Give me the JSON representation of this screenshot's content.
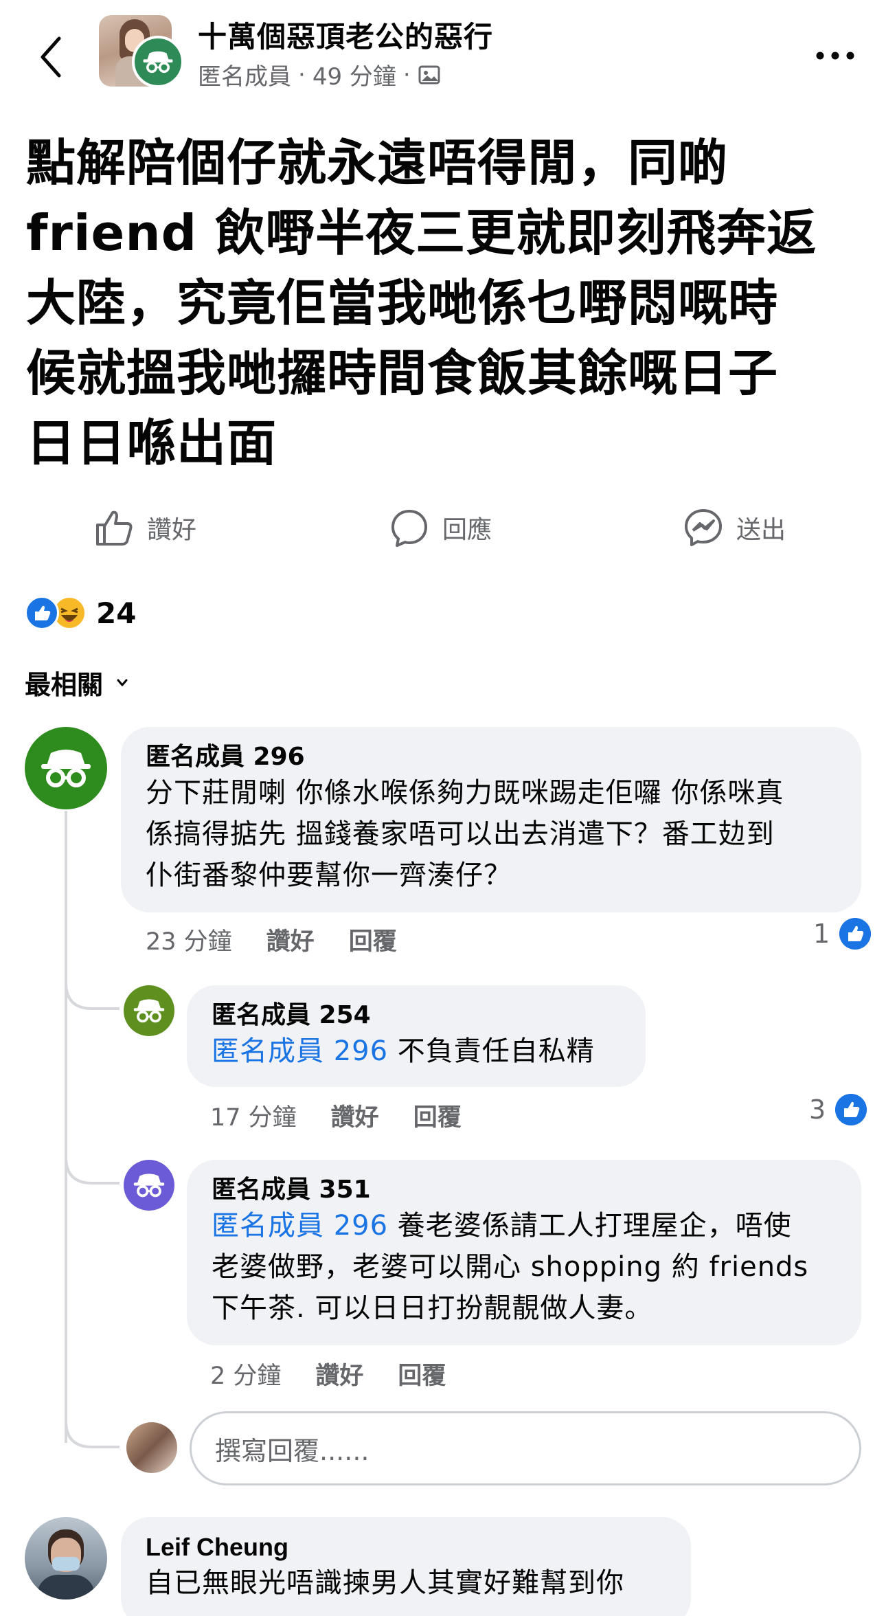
{
  "header": {
    "group_name": "十萬個惡頂老公的惡行",
    "poster": "匿名成員",
    "time": "49 分鐘",
    "separator": "·"
  },
  "post": {
    "lines": [
      "點解陪個仔就永遠唔得閒，同啲",
      "friend 飲嘢半夜三更就即刻飛奔返",
      "大陸，究竟佢當我哋係乜嘢悶嘅時",
      "候就搵我哋攞時間食飯其餘嘅日子",
      "日日喺出面"
    ]
  },
  "actions": {
    "like": "讚好",
    "comment": "回應",
    "send": "送出"
  },
  "reactions": {
    "count": "24"
  },
  "sort": {
    "label": "最相關"
  },
  "comments": [
    {
      "author": "匿名成員 296",
      "lines": [
        "分下莊閒喇 你條水喉係夠力既咪踢走佢囉 你係咪真",
        "係搞得掂先 搵錢養家唔可以出去消遣下？番工攰到",
        "仆街番黎仲要幫你一齊湊仔？"
      ],
      "time": "23 分鐘",
      "like": "讚好",
      "reply": "回覆",
      "likes": "1",
      "avatar_color": "#2e8b1e"
    },
    {
      "author": "匿名成員 254",
      "mention": "匿名成員 296",
      "lines": [
        "不負責任自私精"
      ],
      "time": "17 分鐘",
      "like": "讚好",
      "reply": "回覆",
      "likes": "3",
      "avatar_color": "#5e8f1f"
    },
    {
      "author": "匿名成員 351",
      "mention": "匿名成員 296",
      "lines": [
        "養老婆係請工人打理屋企，唔使",
        "老婆做野，老婆可以開心 shopping 約 friends",
        "下午茶. 可以日日打扮靚靚做人妻。"
      ],
      "time": "2 分鐘",
      "like": "讚好",
      "reply": "回覆"
    }
  ],
  "reply_box": {
    "placeholder": "撰寫回覆......"
  },
  "comment_next": {
    "author": "Leif Cheung",
    "text": "自已無眼光唔識揀男人其實好難幫到你"
  },
  "colors": {
    "accent": "#1b74e4",
    "muted": "#65676b",
    "bubble": "#f0f2f5"
  }
}
